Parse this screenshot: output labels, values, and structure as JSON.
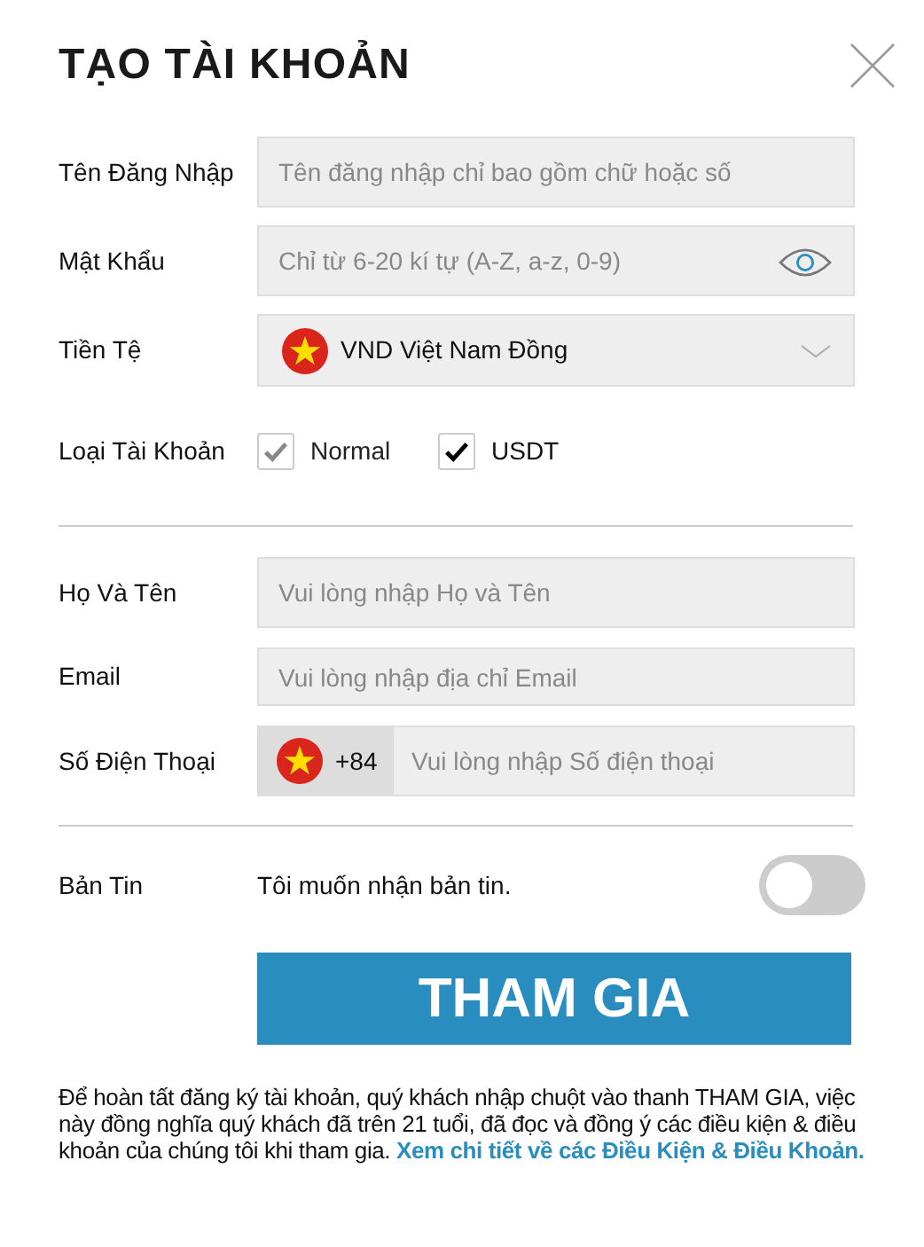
{
  "title": "TẠO TÀI KHOẢN",
  "account_fields": [
    {
      "label": "Tên Đăng Nhập",
      "kind": "text",
      "placeholder": "Tên đăng nhập chỉ bao gồm chữ hoặc số"
    },
    {
      "label": "Mật Khẩu",
      "kind": "password",
      "placeholder": "Chỉ từ 6-20 kí tự (A-Z, a-z, 0-9)"
    },
    {
      "label": "Tiền Tệ",
      "kind": "select",
      "value": "VND Việt Nam Đồng"
    }
  ],
  "account_type": {
    "label": "Loại Tài Khoản",
    "options": [
      {
        "label": "Normal",
        "checked": true,
        "disabled": true
      },
      {
        "label": "USDT",
        "checked": true,
        "disabled": false
      }
    ]
  },
  "personal_fields": [
    {
      "label": "Họ Và Tên",
      "kind": "text",
      "placeholder": "Vui lòng nhập Họ và Tên"
    },
    {
      "label": "Email",
      "kind": "email",
      "placeholder": "Vui lòng nhập địa chỉ Email"
    },
    {
      "label": "Số Điện Thoại",
      "kind": "phone",
      "prefix": "+84",
      "placeholder": "Vui lòng nhập Số điện thoại"
    }
  ],
  "newsletter": {
    "label": "Bản Tin",
    "text": "Tôi muốn nhận bản tin.",
    "on": false
  },
  "submit_button": "THAM GIA",
  "notice": {
    "text": "Để hoàn tất đăng ký tài khoản, quý khách nhập chuột vào thanh THAM GIA, việc này đồng nghĩa quý khách đã trên 21 tuổi, đã đọc và đồng ý các điều kiện & điều khoản của chúng tôi khi tham gia.",
    "link": "Xem chi tiết về các Điều Kiện & Điều Khoản."
  }
}
